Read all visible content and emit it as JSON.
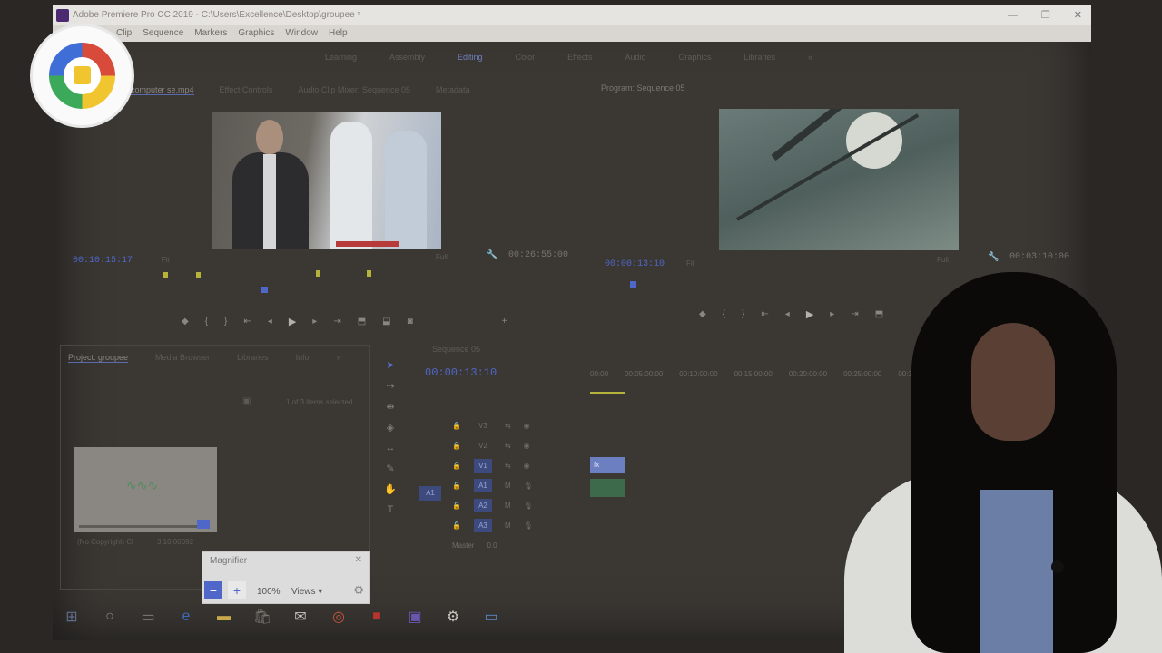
{
  "window": {
    "title": "Adobe Premiere Pro CC 2019 - C:\\Users\\Excellence\\Desktop\\groupee *",
    "controls": [
      "—",
      "❐",
      "✕"
    ]
  },
  "menu": [
    "Clip",
    "Sequence",
    "Markers",
    "Graphics",
    "Window",
    "Help"
  ],
  "workspaces": {
    "items": [
      "Learning",
      "Assembly",
      "Editing",
      "Color",
      "Effects",
      "Audio",
      "Graphics",
      "Libraries",
      "»"
    ],
    "active_index": 2
  },
  "source_panel": {
    "tabs": [
      "computer se.mp4",
      "Effect Controls",
      "Audio Clip Mixer: Sequence 05",
      "Metadata"
    ],
    "timecode": "00:10:15:17",
    "fit": "Fit",
    "quality": "Full",
    "duration": "00:26:55:00"
  },
  "program_panel": {
    "title": "Program: Sequence 05",
    "timecode": "00:00:13:10",
    "fit": "Fit",
    "quality": "Full",
    "duration": "00:03:10:00"
  },
  "transport_icons": [
    "marker-icon",
    "in-point-icon",
    "out-point-icon",
    "go-to-in-icon",
    "step-back-icon",
    "play-icon",
    "step-forward-icon",
    "go-to-out-icon",
    "insert-icon",
    "overwrite-icon",
    "export-frame-icon",
    "add-icon"
  ],
  "project_panel": {
    "tabs": [
      "Project: groupee",
      "Media Browser",
      "Libraries",
      "Info",
      "»"
    ],
    "items_selected": "1 of 3 items selected",
    "item_label": "(No Copyright) Cl",
    "item_duration": "3:10:00092"
  },
  "timeline": {
    "tab": "Sequence 05",
    "timecode": "00:00:13:10",
    "ruler": [
      "00:00",
      "00:05:00:00",
      "00:10:00:00",
      "00:15:00:00",
      "00:20:00:00",
      "00:25:00:00",
      "00:30"
    ],
    "tracks": [
      "V3",
      "V2",
      "V1",
      "A1",
      "A2",
      "A3"
    ],
    "source_patch": "A1",
    "master": "Master",
    "master_value": "0.0",
    "clip_label": "fx"
  },
  "magnifier": {
    "title": "Magnifier",
    "zoom": "100%",
    "views": "Views ▾"
  },
  "taskbar_icons": [
    "windows-start-icon",
    "search-icon",
    "task-view-icon",
    "edge-icon",
    "file-explorer-icon",
    "store-icon",
    "mail-icon",
    "chrome-icon",
    "red-app-icon",
    "premiere-icon",
    "settings-icon",
    "monitor-icon"
  ]
}
